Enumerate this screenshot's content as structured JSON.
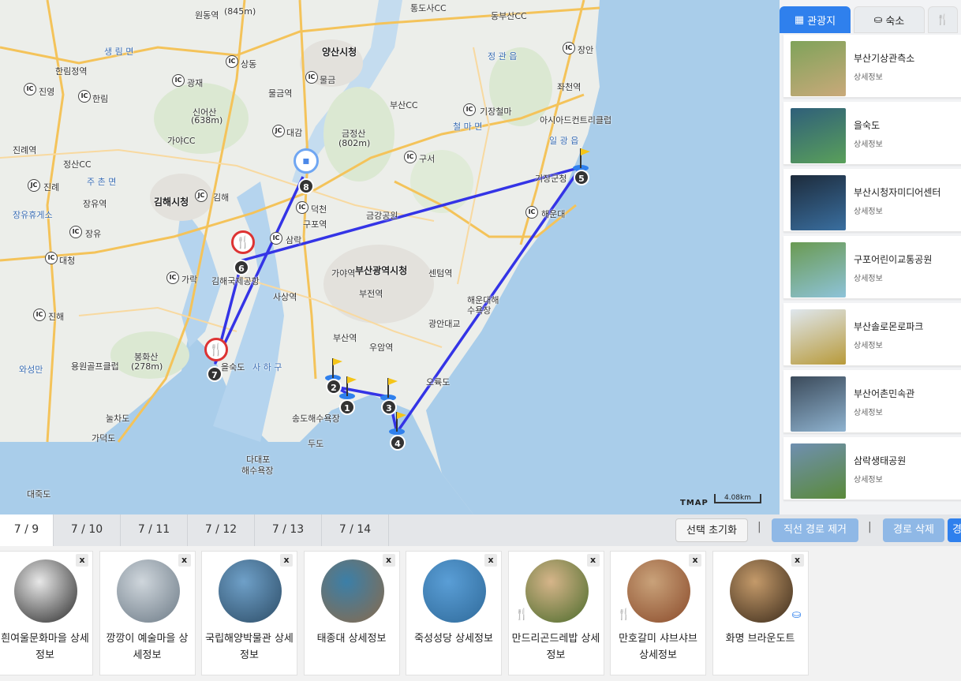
{
  "map": {
    "labels": {
      "l1": "원동역",
      "l2": "(845m)",
      "l3": "통도사CC",
      "l4": "동부산CC",
      "l5": "양산시청",
      "l6": "물금",
      "l7": "물금역",
      "l8": "상동",
      "l9": "광재",
      "l10": "생 림 면",
      "l11": "한림정역",
      "l12": "진영",
      "l13": "한림",
      "l14": "신어산",
      "l15": "(638m)",
      "l16": "가야CC",
      "l17": "대감",
      "l18": "금정산",
      "l19": "(802m)",
      "l20": "부산CC",
      "l21": "기장철마",
      "l22": "장안",
      "l23": "좌천역",
      "l24": "아시아드컨트리클럽",
      "l25": "정산CC",
      "l26": "진례역",
      "l27": "진례",
      "l28": "김해시청",
      "l29": "김해",
      "l30": "장유역",
      "l31": "장유휴게소",
      "l32": "장유",
      "l33": "덕천",
      "l34": "구포역",
      "l35": "삼락",
      "l36": "금강공원",
      "l37": "구서",
      "l38": "기장군청",
      "l39": "해운대",
      "l40": "대청",
      "l41": "가락",
      "l42": "김해국제공항",
      "l43": "가야역",
      "l44": "부산광역시청",
      "l45": "센텀역",
      "l46": "부전역",
      "l47": "사상역",
      "l48": "해운대해수욕장",
      "l49": "광안대교",
      "l50": "진해",
      "l51": "봉화산",
      "l52": "(278m)",
      "l53": "용원골프클럽",
      "l54": "부산역",
      "l55": "우암역",
      "l56": "을숙도",
      "l57": "사 하 구",
      "l58": "와성만",
      "l59": "송도해수욕장",
      "l60": "두도",
      "l61": "다대포",
      "l62": "해수욕장",
      "l63": "가덕도",
      "l64": "눌차도",
      "l65": "대죽도",
      "l66": "오륙도",
      "l67": "철 마 면",
      "l68": "정 관 읍",
      "l69": "일 광 읍",
      "l70": "주 촌 면"
    },
    "route_markers": [
      "1",
      "2",
      "3",
      "4",
      "5",
      "6",
      "7",
      "8"
    ],
    "tmap_logo": "TMAP",
    "scale": "4.08km"
  },
  "side": {
    "tabs": [
      {
        "label": "관광지",
        "icon": "map-icon"
      },
      {
        "label": "숙소",
        "icon": "bed-icon"
      },
      {
        "label": "",
        "icon": "fork-knife-icon"
      }
    ],
    "places": [
      {
        "title": "부산기상관측소",
        "sub": "상세정보",
        "color1": "#7fa35a",
        "color2": "#c9a97a"
      },
      {
        "title": "을숙도",
        "sub": "상세정보",
        "color1": "#2f5f7a",
        "color2": "#5aa05a"
      },
      {
        "title": "부산시청자미디어센터",
        "sub": "상세정보",
        "color1": "#1d2b3b",
        "color2": "#3a6fa0"
      },
      {
        "title": "구포어린이교통공원",
        "sub": "상세정보",
        "color1": "#6a9a52",
        "color2": "#8ec3d9"
      },
      {
        "title": "부산솔로몬로파크",
        "sub": "상세정보",
        "color1": "#dfe7ee",
        "color2": "#b89a3a"
      },
      {
        "title": "부산어촌민속관",
        "sub": "상세정보",
        "color1": "#3b4a5a",
        "color2": "#8fb3d0"
      },
      {
        "title": "삼락생태공원",
        "sub": "상세정보",
        "color1": "#6f8fb0",
        "color2": "#5a8a3a"
      }
    ]
  },
  "days": [
    "7 / 9",
    "7 / 10",
    "7 / 11",
    "7 / 12",
    "7 / 13",
    "7 / 14"
  ],
  "actions": {
    "reset": "선택 초기화",
    "remove_straight": "직선 경로 제거",
    "delete_route": "경로 삭제",
    "extra": "경",
    "sep": "|"
  },
  "itinerary": [
    {
      "name": "흰여울문화마을 상세정보",
      "type": "sight",
      "c1": "#e8e8e8",
      "c2": "#2a2a2a"
    },
    {
      "name": "깡깡이 예술마을 상세정보",
      "type": "sight",
      "c1": "#cfd6dc",
      "c2": "#6c7a86"
    },
    {
      "name": "국립해양박물관 상세정보",
      "type": "sight",
      "c1": "#6fa0c8",
      "c2": "#2c4c66"
    },
    {
      "name": "태종대 상세정보",
      "type": "sight",
      "c1": "#3b7fa8",
      "c2": "#8a6a4a"
    },
    {
      "name": "죽성성당 상세정보",
      "type": "sight",
      "c1": "#5a9ed6",
      "c2": "#2f6a9a"
    },
    {
      "name": "만드리곤드레밥 상세정보",
      "type": "food",
      "c1": "#d6b58a",
      "c2": "#4a6a2a"
    },
    {
      "name": "만호갈미 샤브샤브 상세정보",
      "type": "food",
      "c1": "#c9a27a",
      "c2": "#8a4a2a"
    },
    {
      "name": "화명 브라운도트",
      "type": "stay",
      "c1": "#c49a6a",
      "c2": "#3a2a1a"
    }
  ],
  "x_label": "x",
  "colors": {
    "accent": "#2f80ed",
    "route": "#3434e6",
    "food": "#d33333"
  }
}
